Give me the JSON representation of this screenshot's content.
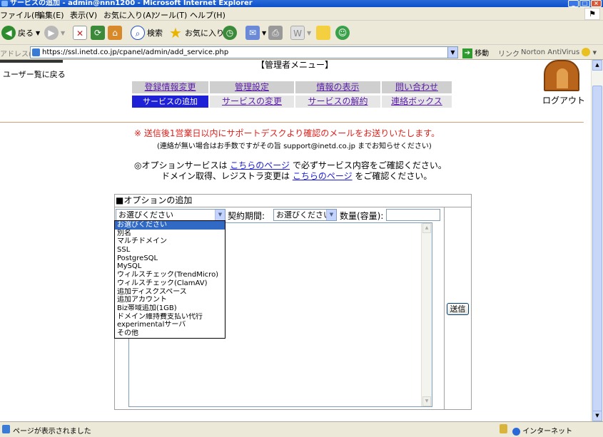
{
  "window": {
    "title": "サービスの追加 - admin@nnn1200 - Microsoft Internet Explorer",
    "buttons": {
      "minimize": "_",
      "maximize": "□",
      "close": "×"
    }
  },
  "menubar": {
    "items": [
      "ファイル(F)",
      "編集(E)",
      "表示(V)",
      "お気に入り(A)",
      "ツール(T)",
      "ヘルプ(H)"
    ]
  },
  "toolbar": {
    "back": "戻る",
    "search": "検索",
    "favorites": "お気に入り"
  },
  "address": {
    "label": "アドレス(D)",
    "url": "https://ssl.inetd.co.jp/cpanel/admin/add_service.php",
    "go": "移動",
    "links": "リンク",
    "norton": "Norton AntiVirus"
  },
  "page": {
    "user_back": "ユーザー覧に戻る",
    "admin_menu_title": "【管理者メニュー】",
    "logout": "ログアウト",
    "nav_row1": [
      "登録情報変更",
      "管理設定",
      "情報の表示",
      "問い合わせ"
    ],
    "nav_row2": [
      "サービスの追加",
      "サービスの変更",
      "サービスの解約",
      "連絡ボックス"
    ],
    "notice_red": "※ 送信後1営業日以内にサポートデスクより確認のメールをお送りいたします。",
    "notice_small": "(連絡が無い場合はお手数ですがその旨 support@inetd.co.jp までお知らせください)",
    "option_line1": {
      "prefix": "◎オプションサービスは ",
      "link": "こちらのページ",
      "suffix": " で必ずサービス内容をご確認ください。"
    },
    "option_line2": {
      "prefix": "ドメイン取得、レジストラ変更は ",
      "link": "こちらのページ",
      "suffix": " をご確認ください。"
    }
  },
  "form": {
    "title": "■オプションの追加",
    "service_select": "お選びください",
    "period_label": "契約期間:",
    "period_select": "お選びください",
    "quantity_label": "数量(容量):",
    "submit": "送信",
    "dropdown_options": [
      "お選びください",
      "別名",
      "マルチドメイン",
      "SSL",
      "PostgreSQL",
      "MySQL",
      "ウィルスチェック(TrendMicro)",
      "ウィルスチェック(ClamAV)",
      "追加ディスクスペース",
      "追加アカウント",
      "Biz帯域追加(1GB)",
      "ドメイン維持費支払い代行",
      "experimentalサーバ",
      "その他"
    ],
    "selected_index": 0
  },
  "status": {
    "text": "ページが表示されました",
    "zone": "インターネット"
  }
}
